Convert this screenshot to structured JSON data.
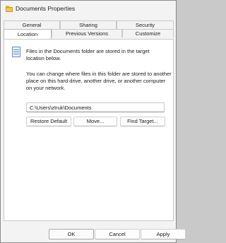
{
  "window": {
    "title": "Documents Properties"
  },
  "tabs": [
    {
      "label": "General"
    },
    {
      "label": "Sharing"
    },
    {
      "label": "Security"
    },
    {
      "label": "Location"
    },
    {
      "label": "Previous Versions"
    },
    {
      "label": "Customize"
    }
  ],
  "location": {
    "description1": "Files in the Documents folder are stored in the target location below.",
    "description2": "You can change where files in this folder are stored to another place on this hard drive, another drive, or another computer on your network.",
    "path_value": "C:\\Users\\ztruk\\Documents",
    "restore_label": "Restore Default",
    "move_label": "Move...",
    "find_label": "Find Target..."
  },
  "footer": {
    "ok_label": "OK",
    "cancel_label": "Cancel",
    "apply_label": "Apply"
  }
}
